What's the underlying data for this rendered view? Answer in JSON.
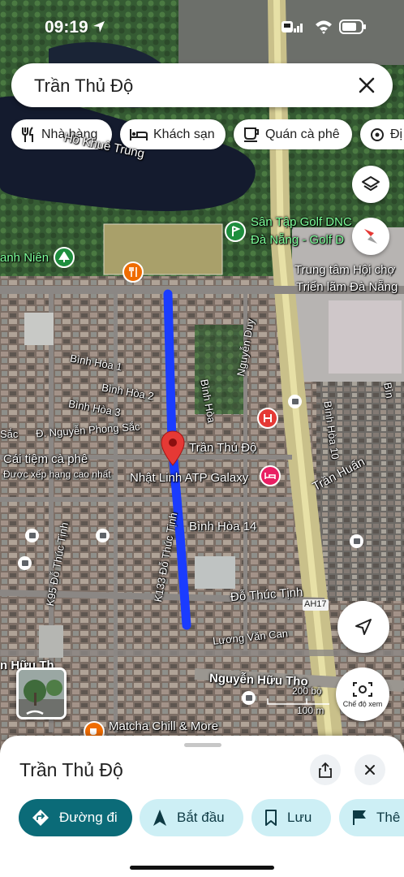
{
  "status_bar": {
    "time": "09:19"
  },
  "search": {
    "query": "Trần Thủ Độ"
  },
  "chips": [
    {
      "icon": "restaurant-icon",
      "label": "Nhà hàng"
    },
    {
      "icon": "hotel-icon",
      "label": "Khách sạn"
    },
    {
      "icon": "coffee-icon",
      "label": "Quán cà phê"
    },
    {
      "icon": "gas-station-icon",
      "label": "Đị"
    }
  ],
  "map_labels": {
    "lake": "Hồ Khuê Trung",
    "golf": "Sân Tập Golf DNC",
    "golf2": "Đà Nẵng - Golf D",
    "park": "anh Niên",
    "center1": "Trung tâm Hội chợ",
    "center2": "Triển lãm Đà Nẵng",
    "binhhoa1": "Bình Hòa 1",
    "binhhoa2": "Bình Hòa 2",
    "binhhoa3": "Bình Hòa 3",
    "nguyenduy": "Nguyễn Duy",
    "binhhoa_v": "Bình Hòa",
    "nguyenphongsac": "Đ. Nguyễn Phong Sắc",
    "sac": "Sắc",
    "tranthudo": "Trần Thủ Độ",
    "caitiem": "Cái tiệm cà phê",
    "xephang": "Được xếp hạng cao nhất",
    "nhatlinh": "Nhật Linh ATP Galaxy",
    "binhhoa10": "Bình Hòa 10",
    "tranhuan": "Trần Huấn",
    "binhhoa14": "Bình Hòa 14",
    "k133": "K133 Đỗ Thúc Tịnh",
    "k95": "K95 Đỗ Thúc Tịnh",
    "dothuctinh": "Đỗ Thúc Tịnh",
    "ah17": "AH17",
    "luongvancan": "Lương Văn Can",
    "nguyenhuutho": "Nguyễn Hữu Thọ",
    "nguyenhuuthu2": "n Hữu Th",
    "matcha": "Matcha Chill & More",
    "cot": "Bìn"
  },
  "scale": {
    "ft": "200 bộ",
    "m": "100 m"
  },
  "view_mode": {
    "label": "Chế độ xem"
  },
  "sheet": {
    "title": "Trần Thủ Độ",
    "actions": [
      {
        "icon": "directions-icon",
        "label": "Đường đi"
      },
      {
        "icon": "navigation-arrow-icon",
        "label": "Bắt đầu"
      },
      {
        "icon": "bookmark-icon",
        "label": "Lưu"
      },
      {
        "icon": "flag-icon",
        "label": "Thê"
      }
    ]
  },
  "colors": {
    "route": "#1a3cff",
    "pin": "#e53935",
    "primary": "#0b6b78",
    "secondary": "#cdeff5"
  }
}
